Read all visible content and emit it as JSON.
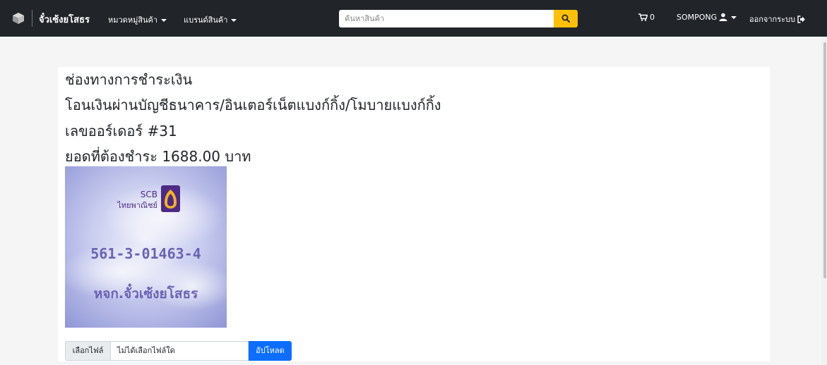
{
  "navbar": {
    "brand": "จั๋วเซ้งยโสธร",
    "menu_category": "หมวดหมู่สินค้า",
    "menu_brand": "แบรนด์สินค้า",
    "search_placeholder": "ค้นหาสินค้า",
    "cart_count": "0",
    "username": "SOMPONG",
    "logout": "ออกจากระบบ"
  },
  "payment": {
    "title": "ช่องทางการชำระเงิน",
    "method": "โอนเงินผ่านบัญชีธนาคาร/อินเตอร์เน็ตแบงก์กิ้ง/โมบายแบงก์กิ้ง",
    "order_line": "เลขออร์เดอร์ #31",
    "amount_line": "ยอดที่ต้องชำระ 1688.00 บาท"
  },
  "bank_image": {
    "bank_code": "SCB",
    "bank_name": "ไทยพาณิชย์",
    "account_number": "561-3-01463-4",
    "account_name": "หจก.จั๋วเซ้งยโสธร"
  },
  "upload": {
    "choose_file_label": "เลือกไฟล์",
    "no_file_text": "ไม่ได้เลือกไฟล์ใด",
    "upload_label": "อัปโหลด"
  },
  "colors": {
    "navbar_bg": "#212529",
    "search_button": "#ffc107",
    "upload_button": "#0d6efd",
    "scb_purple": "#4e2a84",
    "scb_gold": "#f4b223"
  }
}
